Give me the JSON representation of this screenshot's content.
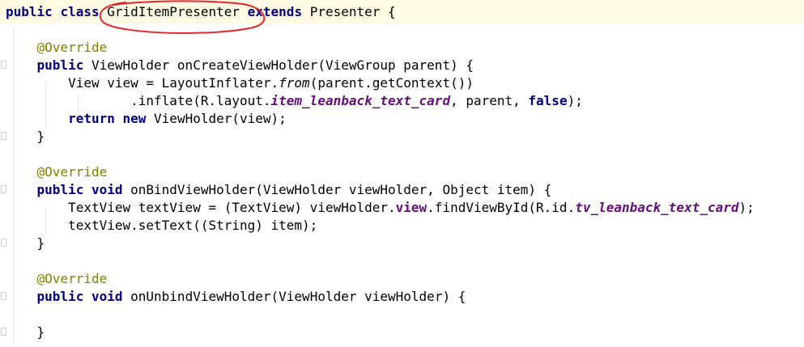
{
  "editor": {
    "lines": [
      {
        "segments": [
          {
            "t": "public",
            "c": "kw"
          },
          {
            "t": " "
          },
          {
            "t": "class",
            "c": "kw"
          },
          {
            "t": " GridItemPresenter "
          },
          {
            "t": "extends",
            "c": "kw"
          },
          {
            "t": " Presenter {"
          }
        ]
      },
      {
        "segments": []
      },
      {
        "segments": [
          {
            "t": "    "
          },
          {
            "t": "@Override",
            "c": "ann"
          }
        ]
      },
      {
        "segments": [
          {
            "t": "    "
          },
          {
            "t": "public",
            "c": "kw"
          },
          {
            "t": " ViewHolder onCreateViewHolder(ViewGroup parent) {"
          }
        ]
      },
      {
        "segments": [
          {
            "t": "        View view = LayoutInflater."
          },
          {
            "t": "from",
            "c": "static-call"
          },
          {
            "t": "(parent.getContext())"
          }
        ]
      },
      {
        "segments": [
          {
            "t": "                .inflate(R.layout."
          },
          {
            "t": "item_leanback_text_card",
            "c": "field-ref"
          },
          {
            "t": ", parent, "
          },
          {
            "t": "false",
            "c": "kw"
          },
          {
            "t": ");"
          }
        ]
      },
      {
        "segments": [
          {
            "t": "        "
          },
          {
            "t": "return",
            "c": "kw"
          },
          {
            "t": " "
          },
          {
            "t": "new",
            "c": "kw"
          },
          {
            "t": " ViewHolder(view);"
          }
        ]
      },
      {
        "segments": [
          {
            "t": "    }"
          }
        ]
      },
      {
        "segments": []
      },
      {
        "segments": [
          {
            "t": "    "
          },
          {
            "t": "@Override",
            "c": "ann"
          }
        ]
      },
      {
        "segments": [
          {
            "t": "    "
          },
          {
            "t": "public",
            "c": "kw"
          },
          {
            "t": " "
          },
          {
            "t": "void",
            "c": "kw"
          },
          {
            "t": " onBindViewHolder(ViewHolder viewHolder, Object item) {"
          }
        ]
      },
      {
        "segments": [
          {
            "t": "        TextView textView = (TextView) viewHolder."
          },
          {
            "t": "view",
            "c": "field-plain"
          },
          {
            "t": ".findViewById(R.id."
          },
          {
            "t": "tv_leanback_text_card",
            "c": "field-ref"
          },
          {
            "t": ");"
          }
        ]
      },
      {
        "segments": [
          {
            "t": "        textView.setText((String) item);"
          }
        ]
      },
      {
        "segments": [
          {
            "t": "    }"
          }
        ]
      },
      {
        "segments": []
      },
      {
        "segments": [
          {
            "t": "    "
          },
          {
            "t": "@Override",
            "c": "ann"
          }
        ]
      },
      {
        "segments": [
          {
            "t": "    "
          },
          {
            "t": "public",
            "c": "kw"
          },
          {
            "t": " "
          },
          {
            "t": "void",
            "c": "kw"
          },
          {
            "t": " onUnbindViewHolder(ViewHolder viewHolder) {"
          }
        ]
      },
      {
        "segments": []
      },
      {
        "segments": [
          {
            "t": "    }"
          }
        ]
      }
    ]
  },
  "colors": {
    "keyword": "#000080",
    "annotation": "#808000",
    "field": "#660e7a",
    "highlight_circle": "#e8262d",
    "current_line": "#fffae3"
  },
  "icons": [
    "fold-marker-icon"
  ]
}
